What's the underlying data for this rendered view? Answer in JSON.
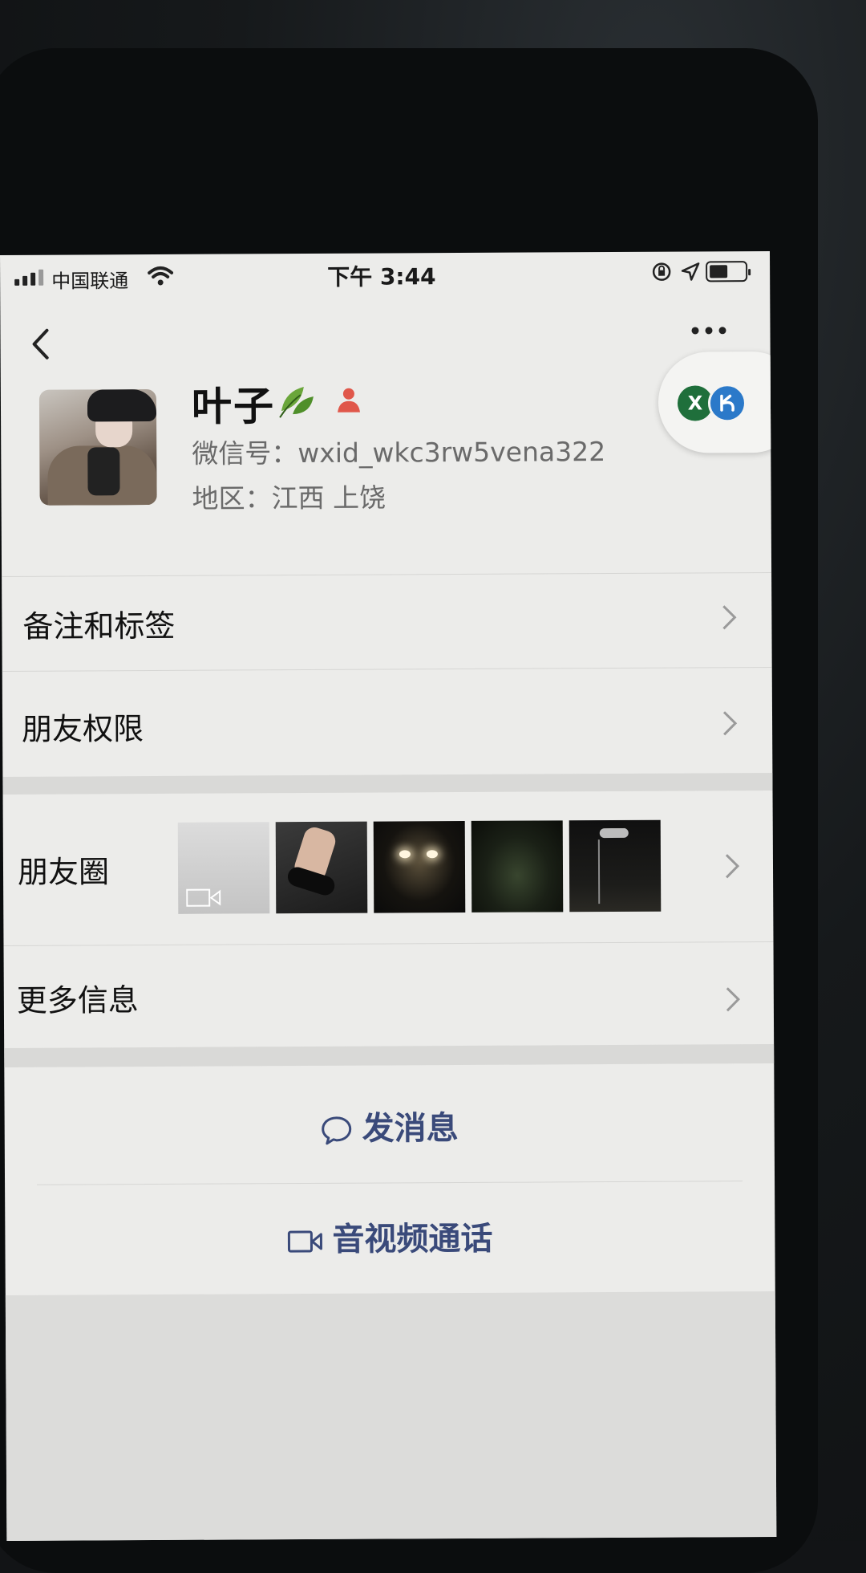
{
  "status_bar": {
    "carrier": "中国联通",
    "time": "下午 3:44"
  },
  "profile": {
    "name": "叶子",
    "wechat_id": "微信号：wxid_wkc3rw5vena322",
    "region": "地区：江西 上饶",
    "name_decoration_icon": "leaf-icon",
    "gender_icon": "female-user-icon"
  },
  "floating_pill": {
    "x_badge": "X"
  },
  "list": {
    "remarks_tags": "备注和标签",
    "friend_permissions": "朋友权限",
    "moments": "朋友圈",
    "more_info": "更多信息"
  },
  "actions": {
    "send_message": "发消息",
    "video_call": "音视频通话"
  },
  "colors": {
    "accent_link": "#3a4a7a",
    "screen_bg": "#ececea"
  }
}
